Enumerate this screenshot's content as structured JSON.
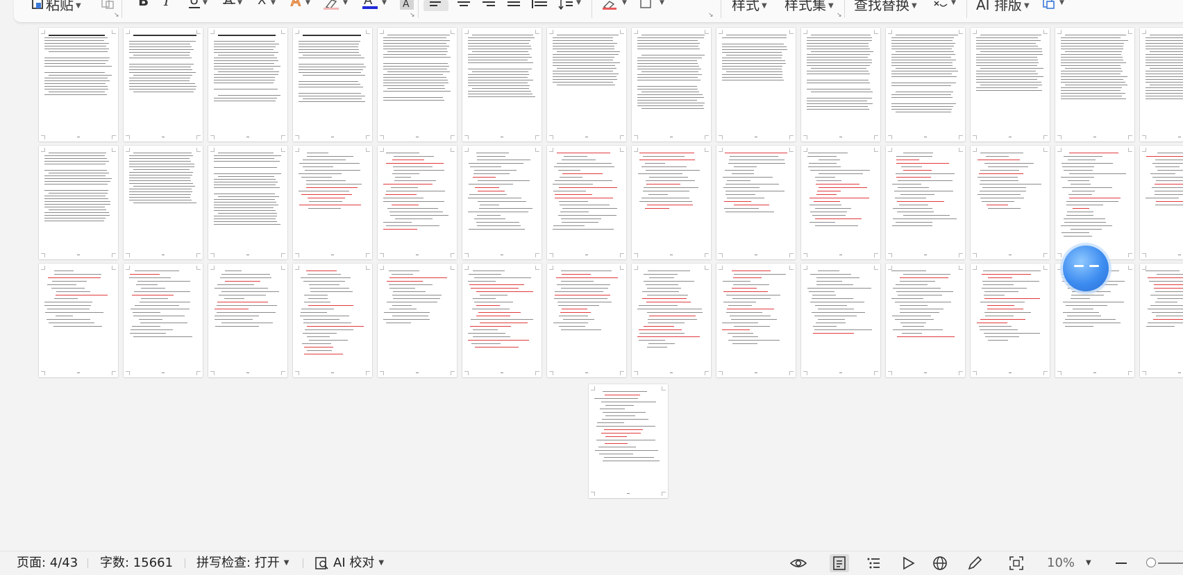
{
  "ribbon": {
    "paste_label": "粘贴",
    "styles_label": "样式",
    "style_set_label": "样式集",
    "find_replace_label": "查找替换",
    "ai_layout_label": "AI 排版"
  },
  "icons": [
    "paste-icon",
    "clipboard-icon",
    "bold-icon",
    "italic-icon",
    "underline-icon",
    "strikethrough-icon",
    "clear-format-icon",
    "text-effect-icon",
    "highlight-icon",
    "font-color-icon",
    "char-shading-icon",
    "align-left-icon",
    "align-center-icon",
    "align-right-icon",
    "justify-icon",
    "distributed-icon",
    "line-spacing-icon",
    "border-icon",
    "shading-icon",
    "select-icon",
    "eye-icon",
    "page-view-icon",
    "outline-icon",
    "play-icon",
    "web-icon",
    "pen-icon",
    "fit-screen-icon",
    "zoom-out-icon"
  ],
  "document": {
    "total_pages": 43,
    "rows_shown": 3,
    "pages_per_row": 14
  },
  "status": {
    "page": "页面: 4/43",
    "word_count": "字数: 15661",
    "spellcheck": "拼写检查: 打开",
    "ai_proofread": "AI 校对",
    "zoom": "10%"
  }
}
